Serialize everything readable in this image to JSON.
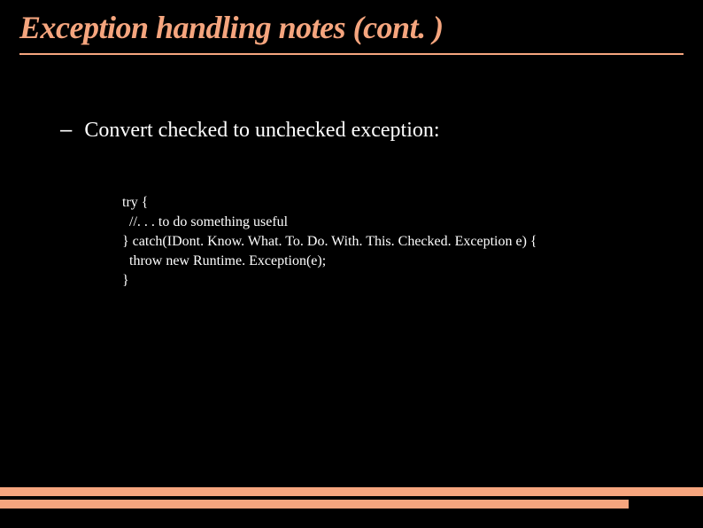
{
  "title": "Exception handling notes (cont. )",
  "bullet": {
    "dash": "–",
    "text": "Convert checked to unchecked exception:"
  },
  "code": {
    "line1": "try {",
    "line2": "  //. . . to do something useful",
    "line3": "} catch(IDont. Know. What. To. Do. With. This. Checked. Exception e) {",
    "line4": "  throw new Runtime. Exception(e);",
    "line5": "}"
  }
}
